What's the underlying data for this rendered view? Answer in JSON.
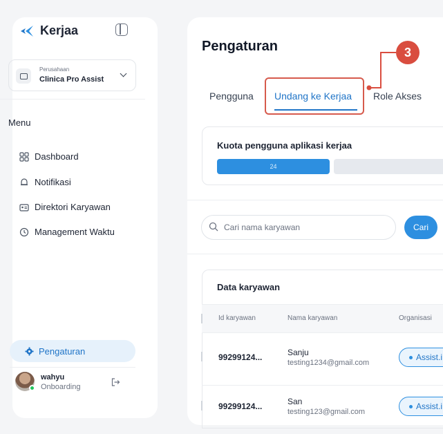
{
  "sidebar": {
    "logo": "Kerjaa",
    "company": {
      "label": "Perusahaan",
      "name": "Clinica Pro Assist"
    },
    "menu_title": "Menu",
    "items": [
      {
        "label": "Dashboard",
        "icon": "grid-icon"
      },
      {
        "label": "Notifikasi",
        "icon": "bell-icon"
      },
      {
        "label": "Direktori Karyawan",
        "icon": "id-card-icon"
      },
      {
        "label": "Management Waktu",
        "icon": "clock-icon"
      }
    ],
    "settings": {
      "label": "Pengaturan",
      "icon": "gear-icon"
    },
    "user": {
      "name": "wahyu",
      "role": "Onboarding"
    }
  },
  "main": {
    "title": "Pengaturan",
    "tabs": [
      {
        "label": "Pengguna"
      },
      {
        "label": "Undang ke Kerjaa",
        "active": true
      },
      {
        "label": "Role Akses"
      }
    ],
    "callout": "3",
    "quota": {
      "title": "Kuota pengguna aplikasi kerjaa",
      "value": "24"
    },
    "search": {
      "placeholder": "Cari nama karyawan",
      "button": "Cari"
    },
    "table": {
      "title": "Data karyawan",
      "columns": [
        "Id karyawan",
        "Nama karyawan",
        "Organisasi"
      ],
      "rows": [
        {
          "id": "99299124...",
          "name": "Sanju",
          "email": "testing1234@gmail.com",
          "org": "Assist.i"
        },
        {
          "id": "99299124...",
          "name": "San",
          "email": "testing123@gmail.com",
          "org": "Assist.i"
        }
      ]
    }
  },
  "colors": {
    "accent": "#2d8fe0",
    "highlight": "#d65a4c"
  }
}
